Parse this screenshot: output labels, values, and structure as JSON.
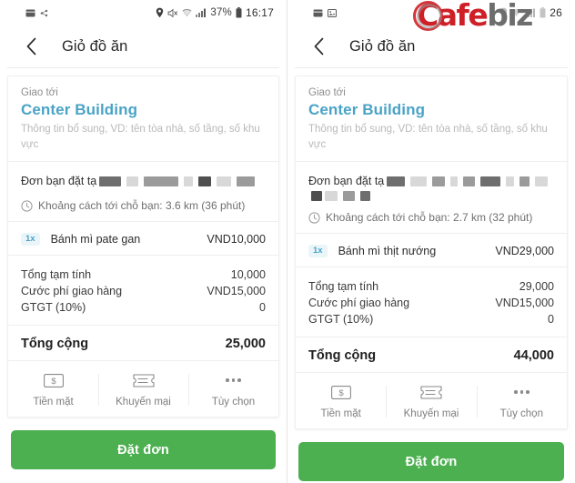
{
  "screens": [
    {
      "id": "left",
      "statusbar": {
        "left_icons": [
          "wallet-icon",
          "bluetooth-share-icon"
        ],
        "location_icon": "location-pin-icon",
        "mute_icon": "mute-icon",
        "wifi_icon": "wifi-icon",
        "signal_icon": "signal-bars-icon",
        "battery_percent": "37%",
        "battery_icon": "battery-icon",
        "time": "16:17"
      },
      "appbar": {
        "back_icon": "chevron-left-icon",
        "title": "Giỏ đồ ăn"
      },
      "delivery": {
        "label": "Giao tới",
        "address": "Center Building",
        "hint": "Thông tin bổ sung, VD: tên tòa nhà, số tầng, số khu vực"
      },
      "order_from": {
        "label": "Đơn bạn đặt tạ",
        "redacted": true
      },
      "distance": {
        "clock_icon": "clock-icon",
        "text": "Khoảng cách tới chỗ bạn: 3.6 km (36 phút)"
      },
      "items": [
        {
          "qty": "1x",
          "name": "Bánh mì pate gan",
          "price": "VND10,000"
        }
      ],
      "totals": [
        {
          "label": "Tổng tạm tính",
          "value": "10,000"
        },
        {
          "label": "Cước phí giao hàng",
          "value": "VND15,000"
        },
        {
          "label": "GTGT (10%)",
          "value": "0"
        }
      ],
      "grand_total": {
        "label": "Tổng cộng",
        "value": "25,000"
      },
      "actions": [
        {
          "icon": "cash-icon",
          "label": "Tiền mặt"
        },
        {
          "icon": "voucher-ticket-icon",
          "label": "Khuyến mại"
        },
        {
          "icon": "more-options-icon",
          "label": "Tùy chọn"
        }
      ],
      "submit": {
        "label": "Đặt đơn",
        "color": "#4caf50"
      }
    },
    {
      "id": "right",
      "statusbar": {
        "left_icons": [
          "wallet-icon",
          "image-icon"
        ],
        "location_icon": "location-pin-icon",
        "mute_icon": "mute-icon",
        "wifi_icon": "wifi-icon",
        "signal_icon": "signal-bars-icon",
        "battery_percent": "",
        "battery_icon": "battery-icon",
        "time": "26"
      },
      "watermark": {
        "part1": "Cafe",
        "part2": "biz"
      },
      "appbar": {
        "back_icon": "chevron-left-icon",
        "title": "Giỏ đồ ăn"
      },
      "delivery": {
        "label": "Giao tới",
        "address": "Center Building",
        "hint": "Thông tin bổ sung, VD: tên tòa nhà, số tầng, số khu vực"
      },
      "order_from": {
        "label": "Đơn bạn đặt tạ",
        "redacted": true
      },
      "distance": {
        "clock_icon": "clock-icon",
        "text": "Khoảng cách tới chỗ bạn: 2.7 km (32 phút)"
      },
      "items": [
        {
          "qty": "1x",
          "name": "Bánh mì thịt nướng",
          "price": "VND29,000"
        }
      ],
      "totals": [
        {
          "label": "Tổng tạm tính",
          "value": "29,000"
        },
        {
          "label": "Cước phí giao hàng",
          "value": "VND15,000"
        },
        {
          "label": "GTGT (10%)",
          "value": "0"
        }
      ],
      "grand_total": {
        "label": "Tổng cộng",
        "value": "44,000"
      },
      "actions": [
        {
          "icon": "cash-icon",
          "label": "Tiền mặt"
        },
        {
          "icon": "voucher-ticket-icon",
          "label": "Khuyến mại"
        },
        {
          "icon": "more-options-icon",
          "label": "Tùy chọn"
        }
      ],
      "submit": {
        "label": "Đặt đơn",
        "color": "#4caf50"
      }
    }
  ]
}
